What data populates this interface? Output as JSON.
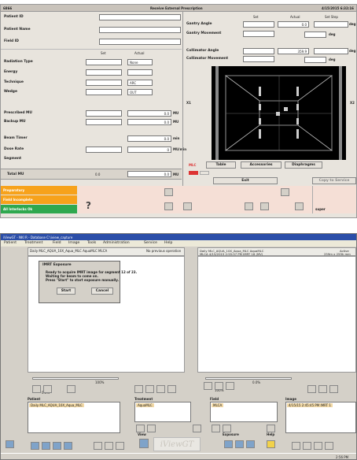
{
  "top": {
    "title_left": "6866",
    "title_center": "Receive External Prescription",
    "title_right": "4/15/2015 6:32:16",
    "fields": [
      {
        "label": "Patient ID"
      },
      {
        "label": "Patient Name"
      },
      {
        "label": "Field ID"
      }
    ],
    "col_set": "Set",
    "col_actual": "Actual",
    "rows": [
      {
        "label": "Radiation Type",
        "actual": "None"
      },
      {
        "label": "Energy",
        "actual": ""
      },
      {
        "label": "Technique",
        "actual": "ARC"
      },
      {
        "label": "Wedge",
        "actual": "OUT"
      }
    ],
    "mu_rows": [
      {
        "label": "Prescribed MU",
        "value": "0.0",
        "unit": "MU"
      },
      {
        "label": "Backup MU",
        "value": "0.0",
        "unit": "MU"
      },
      {
        "label": "Beam Timer",
        "value": "0.0",
        "unit": "min"
      },
      {
        "label": "Dose Rate",
        "value": "0",
        "unit": "MU/min"
      },
      {
        "label": "Segment",
        "value": "",
        "unit": ""
      }
    ],
    "total_mu_label": "Total MU",
    "total_mu_set": "0.0",
    "total_mu_actual": "0.0",
    "total_mu_unit": "MU",
    "status": [
      {
        "text": "Preparatory",
        "color": "#f7a21b"
      },
      {
        "text": "Field Incomplete",
        "color": "#f7a21b"
      },
      {
        "text": "All Interlocks Ok",
        "color": "#28a745"
      }
    ],
    "gantry": {
      "set": "Set",
      "actual": "Actual",
      "setstep": "Set Step",
      "angle_label": "Gantry Angle",
      "angle_actual": "0.0",
      "angle_unit": "deg",
      "movement_label": "Gantry Movement",
      "movement_unit": "deg"
    },
    "collimator": {
      "angle_label": "Collimator Angle",
      "angle_actual": "359.9",
      "angle_unit": "deg",
      "movement_label": "Collimator Movement",
      "movement_unit": "deg"
    },
    "x1": "X1",
    "x2": "X2",
    "tabs": {
      "mlc": "MLC",
      "table": "Table",
      "accessories": "Accessories",
      "diaphragms": "Diaphragms"
    },
    "exit": "Exit",
    "copy_to_service": "Copy to Service",
    "user": "super",
    "help_glyph": "?"
  },
  "bottom": {
    "title": "iViewGT - NKI R - Database C:\\iview_capture",
    "menu": [
      "Patient",
      "Treatment",
      "Field",
      "Image",
      "Tools",
      "Administration",
      "Service",
      "Help"
    ],
    "left_header": "Daily MLC_AQUA_10X_Aqua_MLC  AquaMLC  MLCA",
    "no_prev": "No previous operation",
    "right_header_1": "Daily MLC_AQUA_10X_Aqua_MLC  AquaMLC",
    "right_header_2": "MLCA  4/15/2015 2:55:57 PM  IMRT 18 (MV)",
    "right_active": "Active",
    "right_size": "259m x 259h mm",
    "dialog": {
      "title": "IMRT Exposure",
      "line1": "Ready to acquire IMRT image for segment 12 of 23.",
      "line2": "Waiting for beam to come on.",
      "line3": "Press \"Start\" to start exposure manually.",
      "start": "Start",
      "cancel": "Cancel"
    },
    "zoom_left": "100%",
    "zoom_right": "100%",
    "level_left": "0.0%",
    "level_right": "0.0%",
    "panels": [
      {
        "label": "Patient",
        "item": "Daily MLC_AQUA_10X_Aqua_MLC"
      },
      {
        "label": "Treatment",
        "item": "AquaMLC"
      },
      {
        "label": "Field",
        "item": "MLCA"
      },
      {
        "label": "Image",
        "item": "4/15/15  2:45:45 PM  IMRT 1"
      }
    ],
    "view_label": "View",
    "exposure_label": "Exposure",
    "help_label": "Help",
    "brand": "iViewGT",
    "clock": "2:56 PM"
  }
}
